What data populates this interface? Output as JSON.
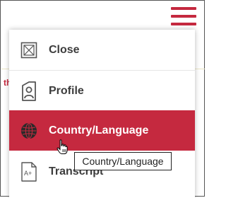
{
  "background": {
    "partial_text": "th"
  },
  "menu": {
    "items": [
      {
        "label": "Close",
        "icon": "close-box-icon",
        "active": false
      },
      {
        "label": "Profile",
        "icon": "profile-document-icon",
        "active": false
      },
      {
        "label": "Country/Language",
        "icon": "globe-icon",
        "active": true
      },
      {
        "label": "Transcript",
        "icon": "transcript-grade-icon",
        "active": false
      }
    ],
    "transcript_icon_text": "A+"
  },
  "tooltip": {
    "text": "Country/Language"
  },
  "colors": {
    "accent": "#c5293f",
    "menu_text": "#3d3d3d",
    "icon": "#555555"
  }
}
